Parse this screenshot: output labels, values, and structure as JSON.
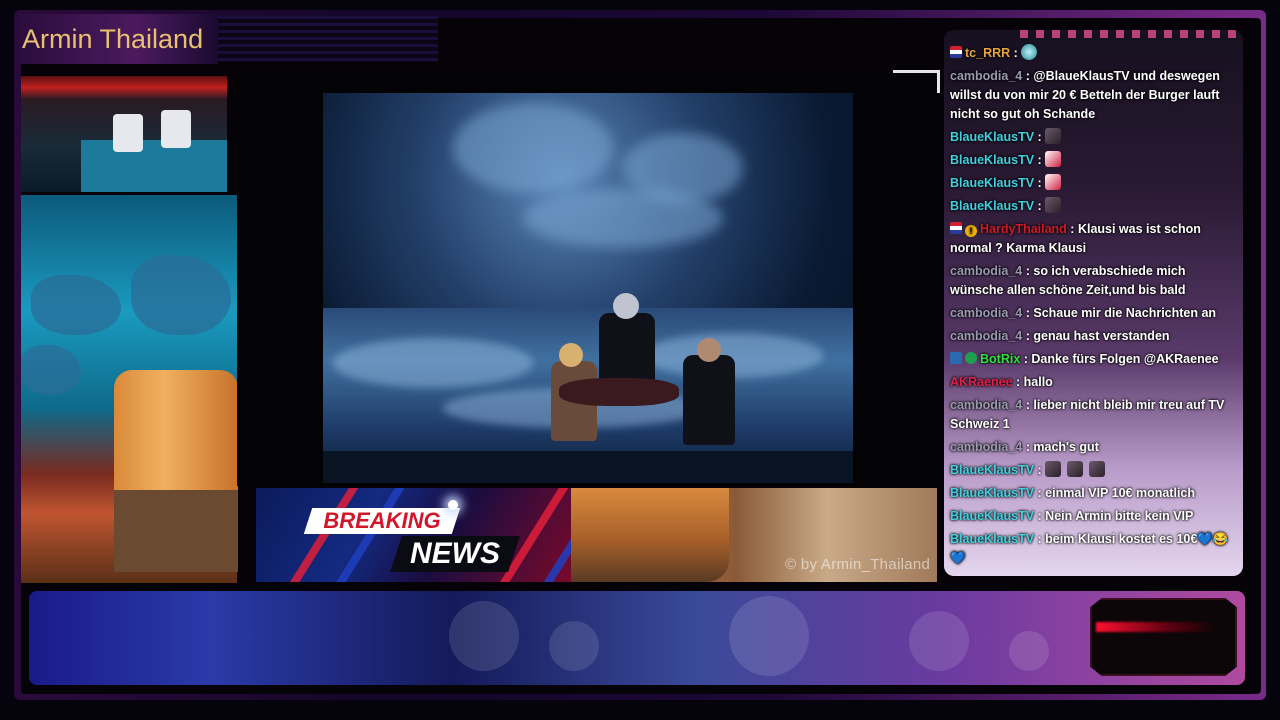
{
  "overlay": {
    "streamer_name": "Armin Thailand",
    "watermark": "© by Armin_Thailand"
  },
  "breaking_news": {
    "line1": "BREAKING",
    "line2": "NEWS"
  },
  "chat": {
    "messages": [
      {
        "user": "tc_RRR",
        "user_color": "#e8a640",
        "badges": [
          "flag-icon"
        ],
        "text": "",
        "emotes": [
          "globe-emote"
        ]
      },
      {
        "user": "cambodia_4",
        "user_color": "#9a9ab0",
        "badges": [],
        "text": "@BlaueKlausTV und deswegen willst du von mir 20 € Betteln der Burger lauft nicht so gut oh Schande"
      },
      {
        "user": "BlaueKlausTV",
        "user_color": "#40d0e0",
        "badges": [],
        "text": "",
        "emotes": [
          "emote"
        ]
      },
      {
        "user": "BlaueKlausTV",
        "user_color": "#40d0e0",
        "badges": [],
        "text": "",
        "emotes": [
          "emote-red"
        ]
      },
      {
        "user": "BlaueKlausTV",
        "user_color": "#40d0e0",
        "badges": [],
        "text": "",
        "emotes": [
          "emote-red"
        ]
      },
      {
        "user": "BlaueKlausTV",
        "user_color": "#40d0e0",
        "badges": [],
        "text": "",
        "emotes": [
          "emote"
        ]
      },
      {
        "user": "HardyThailand",
        "user_color": "#d01a2a",
        "badges": [
          "flag-icon",
          "warning-icon"
        ],
        "text": "Klausi was ist schon normal ? Karma Klausi"
      },
      {
        "user": "cambodia_4",
        "user_color": "#9a9ab0",
        "badges": [],
        "text": "so ich verabschiede mich wünsche allen schöne Zeit,und bis bald"
      },
      {
        "user": "cambodia_4",
        "user_color": "#9a9ab0",
        "badges": [],
        "text": "Schaue mir die Nachrichten an"
      },
      {
        "user": "cambodia_4",
        "user_color": "#9a9ab0",
        "badges": [],
        "text": "genau hast verstanden"
      },
      {
        "user": "BotRix",
        "user_color": "#30e040",
        "badges": [
          "bot-icon",
          "verified-icon"
        ],
        "text": "Danke fürs Folgen @AKRaenee"
      },
      {
        "user": "AKRaenee",
        "user_color": "#e0204a",
        "badges": [],
        "text": "hallo"
      },
      {
        "user": "cambodia_4",
        "user_color": "#9a9ab0",
        "badges": [],
        "text": "lieber nicht bleib mir treu auf TV Schweiz 1"
      },
      {
        "user": "cambodia_4",
        "user_color": "#9a9ab0",
        "badges": [],
        "text": "mach's gut"
      },
      {
        "user": "BlaueKlausTV",
        "user_color": "#40d0e0",
        "badges": [],
        "text": "",
        "emotes": [
          "emote",
          "emote",
          "emote"
        ]
      },
      {
        "user": "BlaueKlausTV",
        "user_color": "#40d0e0",
        "badges": [],
        "text": "einmal VIP 10€ monatlich"
      },
      {
        "user": "BlaueKlausTV",
        "user_color": "#40d0e0",
        "badges": [],
        "text": "Nein Armin bitte kein VIP"
      },
      {
        "user": "BlaueKlausTV",
        "user_color": "#40d0e0",
        "badges": [],
        "text": "beim Klausi kostet es 10€💙😂💙"
      }
    ]
  }
}
